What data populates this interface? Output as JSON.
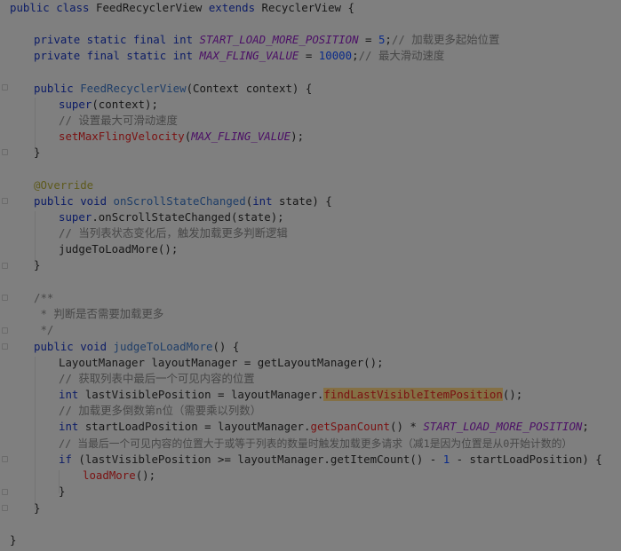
{
  "editor": {
    "language": "Java",
    "lines": {
      "l1": [
        "public class ",
        "FeedRecyclerView ",
        "extends ",
        "RecyclerView {"
      ],
      "l3": [
        "private static final int ",
        "START_LOAD_MORE_POSITION",
        " = ",
        "5",
        ";",
        "// 加载更多起始位置"
      ],
      "l4": [
        "private final static int ",
        "MAX_FLING_VALUE",
        " = ",
        "10000",
        ";",
        "// 最大滑动速度"
      ],
      "l6": [
        "public ",
        "FeedRecyclerView",
        "(Context context) {"
      ],
      "l7": [
        "super",
        "(context);"
      ],
      "l8": [
        "// 设置最大可滑动速度"
      ],
      "l9": [
        "setMaxFlingVelocity",
        "(",
        "MAX_FLING_VALUE",
        ");"
      ],
      "l10": [
        "}"
      ],
      "l12": [
        "@Override"
      ],
      "l13": [
        "public void ",
        "onScrollStateChanged",
        "(",
        "int ",
        "state) {"
      ],
      "l14": [
        "super",
        ".onScrollStateChanged(state);"
      ],
      "l15": [
        "// 当列表状态变化后，触发加载更多判断逻辑"
      ],
      "l16": [
        "judgeToLoadMore();"
      ],
      "l17": [
        "}"
      ],
      "l19": [
        "/**"
      ],
      "l20": [
        " * 判断是否需要加载更多"
      ],
      "l21": [
        " */"
      ],
      "l22": [
        "public void ",
        "judgeToLoadMore",
        "() {"
      ],
      "l23": [
        "LayoutManager layoutManager = getLayoutManager();"
      ],
      "l24": [
        "// 获取列表中最后一个可见内容的位置"
      ],
      "l25": [
        "int ",
        "lastVisiblePosition = layoutManager.",
        "findLastVisibleItemPosition",
        "();"
      ],
      "l26": [
        "// 加载更多倒数第n位（需要乘以列数）"
      ],
      "l27": [
        "int ",
        "startLoadPosition = layoutManager.",
        "getSpanCount",
        "() * ",
        "START_LOAD_MORE_POSITION",
        ";"
      ],
      "l28": [
        "// 当最后一个可见内容的位置大于或等于列表的数量时触发加载更多请求（减1是因为位置是从0开始计数的）"
      ],
      "l29": [
        "if ",
        "(lastVisiblePosition >= layoutManager.getItemCount() - ",
        "1",
        " - startLoadPosition) {"
      ],
      "l30": [
        "loadMore",
        "();"
      ],
      "l31": [
        "}"
      ],
      "l32": [
        "}"
      ],
      "l34": [
        "}"
      ]
    }
  },
  "colors": {
    "background": "#7f7f7f",
    "keyword": "#0c1c66",
    "field": "#4b0f66",
    "number": "#0a2a8a",
    "comment": "#474747",
    "annotation": "#5e5a1c",
    "method_declaration": "#1f3e68",
    "error_highlight": "#7a1212",
    "usage_highlight": "#847045"
  }
}
